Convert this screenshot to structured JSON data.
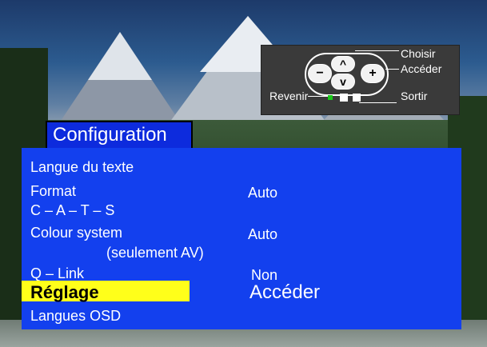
{
  "help": {
    "choose_label": "Choisir",
    "access_label": "Accéder",
    "back_label": "Revenir",
    "exit_label": "Sortir",
    "btn_minus": "−",
    "btn_plus": "+",
    "btn_up": "^",
    "btn_down": "v"
  },
  "menu": {
    "title": "Configuration",
    "items": [
      {
        "label": "Langue du texte",
        "value": ""
      },
      {
        "label": "Format",
        "value": "Auto"
      },
      {
        "label": "C – A – T – S",
        "value": ""
      },
      {
        "label": "Colour system",
        "value": "Auto"
      },
      {
        "label": "(seulement AV)",
        "value": ""
      },
      {
        "label": "Q – Link",
        "value": "Non"
      },
      {
        "label": "Réglage",
        "value": "Accéder"
      },
      {
        "label": "Langues OSD",
        "value": ""
      }
    ]
  },
  "colors": {
    "panel": "#1340ee",
    "title_box": "#0d2bdd",
    "highlight": "#ffff1a",
    "help_panel": "#3a3a3a",
    "indicator_green": "#19c919"
  }
}
